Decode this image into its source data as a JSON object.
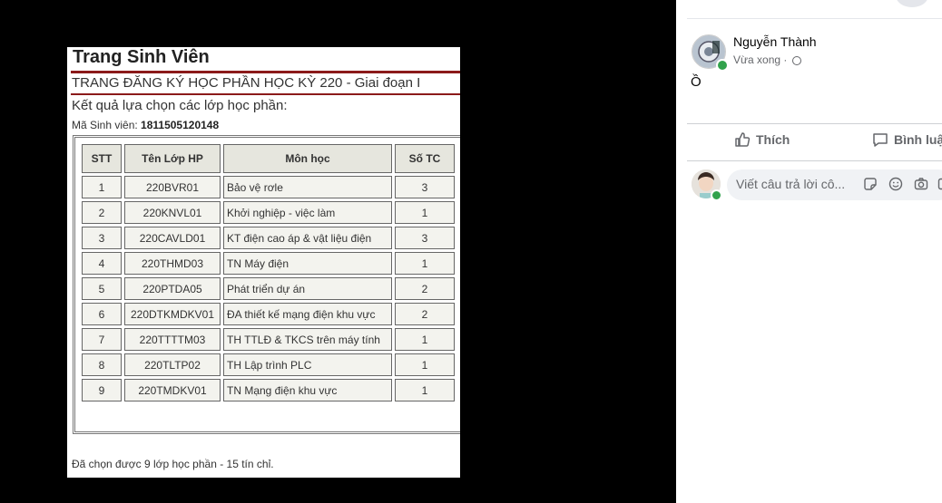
{
  "photo": {
    "title": "Trang Sinh Viên",
    "subtitle": "TRANG ĐĂNG KÝ HỌC PHẦN HỌC KỲ 220 - Giai đoạn I",
    "result_label": "Kết quả lựa chọn các lớp học phần:",
    "student_id_label": "Mã Sinh viên:",
    "student_id": "1811505120148",
    "table": {
      "headers": [
        "STT",
        "Tên Lớp HP",
        "Môn học",
        "Số TC"
      ],
      "rows": [
        [
          "1",
          "220BVR01",
          "Bảo vệ rơle",
          "3"
        ],
        [
          "2",
          "220KNVL01",
          "Khởi nghiệp - việc làm",
          "1"
        ],
        [
          "3",
          "220CAVLD01",
          "KT điện cao áp & vật liệu điện",
          "3"
        ],
        [
          "4",
          "220THMD03",
          "TN Máy điện",
          "1"
        ],
        [
          "5",
          "220PTDA05",
          "Phát triển dự án",
          "2"
        ],
        [
          "6",
          "220DTKMDKV01",
          "ĐA thiết kế mạng điện khu vực",
          "2"
        ],
        [
          "7",
          "220TTTTM03",
          "TH TTLĐ & TKCS trên máy tính",
          "1"
        ],
        [
          "8",
          "220TLTP02",
          "TH Lập trình PLC",
          "1"
        ],
        [
          "9",
          "220TMDKV01",
          "TN Mạng điện khu vực",
          "1"
        ]
      ]
    },
    "summary": "Đã chọn được 9 lớp học phần - 15 tín chỉ."
  },
  "post": {
    "author": "Nguyễn Thành",
    "time": "Vừa xong",
    "separator": "·",
    "text": "Ồ",
    "like_label": "Thích",
    "comment_label": "Bình luận",
    "comment_placeholder": "Viết câu trả lời cô..."
  },
  "colors": {
    "online": "#31a24c",
    "header_rule": "#8b1a1a",
    "secondary_text": "#65676b"
  }
}
